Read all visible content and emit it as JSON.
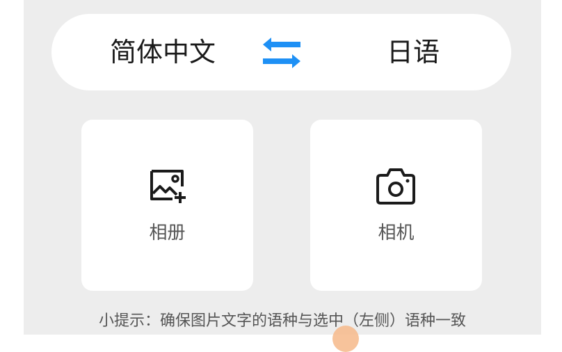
{
  "languages": {
    "source": "简体中文",
    "target": "日语",
    "swap_icon": "swap-arrows-icon"
  },
  "options": {
    "album": {
      "label": "相册",
      "icon": "image-add-icon"
    },
    "camera": {
      "label": "相机",
      "icon": "camera-icon"
    }
  },
  "tip": "小提示：确保图片文字的语种与选中（左侧）语种一致",
  "colors": {
    "accent": "#1e90f5",
    "panel": "#ededed",
    "card": "#ffffff",
    "touch_dot": "#f6b98a"
  }
}
